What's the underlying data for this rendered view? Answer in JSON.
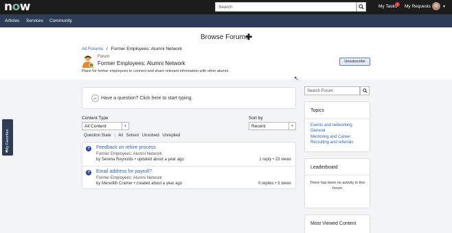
{
  "topbar": {
    "logo": "now",
    "search_placeholder": "Search",
    "my_tasks_label": "My Tasks",
    "my_tasks_count": "1",
    "my_requests_label": "My Requests"
  },
  "menubar": {
    "items": [
      "Articles",
      "Services",
      "Community"
    ]
  },
  "header": {
    "title": "Browse Forums",
    "plus": "✚",
    "breadcrumb_root": "All Forums",
    "breadcrumb_sep": "/",
    "breadcrumb_current": "Former Employees: Alumni Network",
    "forum_label": "Forum",
    "forum_name": "Former Employees: Alumni Network",
    "forum_description": "Place for former employees to connect and share relevant information with other alumni.",
    "unsubscribe_label": "Unsubscribe"
  },
  "question": {
    "avatar_initials": "AL",
    "prompt": "Have a question?",
    "cta": "Click here to start typing."
  },
  "filters": {
    "content_type_label": "Content Type",
    "content_type_value": "All Content",
    "sort_label": "Sort by",
    "sort_value": "Recent",
    "question_state_label": "Question State",
    "sep": "|",
    "states": [
      "All",
      "Solved",
      "Unsolved",
      "Unreplied"
    ]
  },
  "posts": [
    {
      "title": "Feedback on rehire process",
      "forum": "Former Employees: Alumni Network",
      "meta": "by Serena Reynolds • updated about a year ago",
      "stats": "1 reply • 23 views"
    },
    {
      "title": "Email address for payroll?",
      "forum": "Former Employees: Alumni Network",
      "meta": "by Meredith Cramer • created about a year ago",
      "stats": "0 replies • 3 views"
    }
  ],
  "sidebar": {
    "search_placeholder": "Search Forum",
    "topics_title": "Topics",
    "topics": [
      "Events and networking",
      "General",
      "Mentoring and Career",
      "Recruiting and referrals"
    ],
    "leaderboard_title": "Leaderboard",
    "leaderboard_empty": "There has been no activity in this forum",
    "most_viewed_title": "Most Viewed Content"
  },
  "favorites": {
    "label": "My Favorites"
  },
  "colors": {
    "topbar": "#1c1c1c",
    "menubar": "#2e3d55",
    "link": "#2e61b5",
    "question_icon": "#2b4aa8"
  },
  "icons": [
    "search-icon",
    "plus-icon",
    "forum-person-icon",
    "question-icon",
    "star-icon",
    "chevron-down-icon"
  ]
}
